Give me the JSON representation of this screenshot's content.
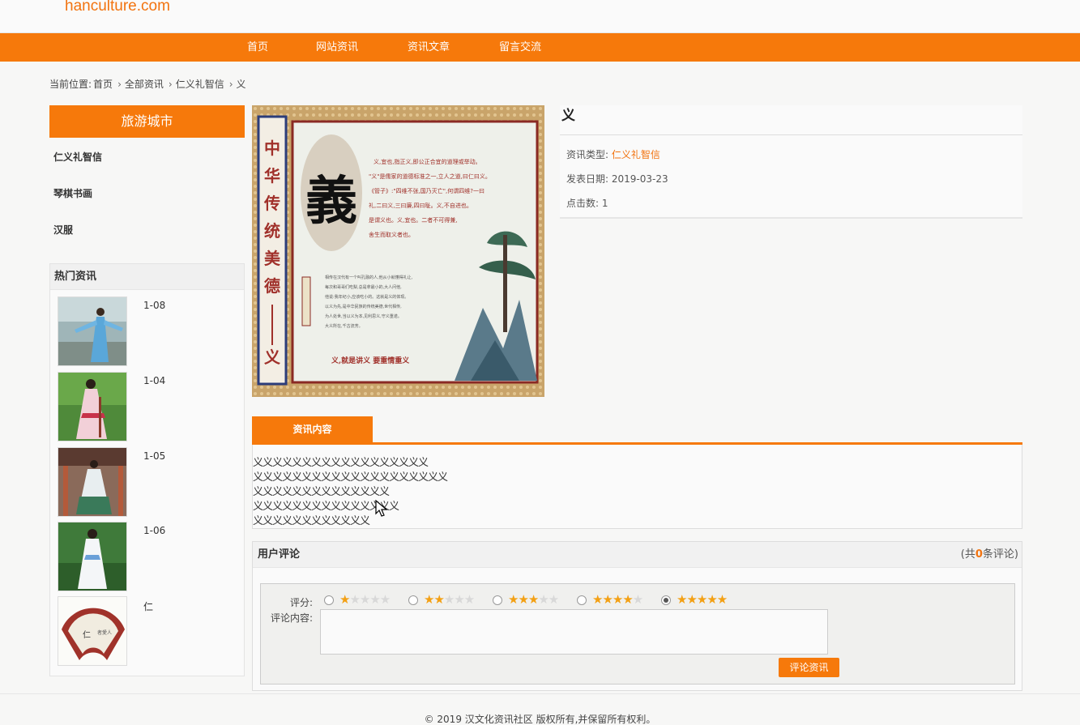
{
  "site": {
    "logo": "hanculture.com"
  },
  "nav": {
    "items": [
      {
        "label": "首页"
      },
      {
        "label": "网站资讯"
      },
      {
        "label": "资讯文章"
      },
      {
        "label": "留言交流"
      }
    ]
  },
  "breadcrumb": {
    "prefix": "当前位置:",
    "items": [
      "首页",
      "全部资讯",
      "仁义礼智信",
      "义"
    ]
  },
  "sidebar": {
    "category_header": "旅游城市",
    "categories": [
      "仁义礼智信",
      "琴棋书画",
      "汉服"
    ],
    "hot_title": "热门资讯",
    "hot_items": [
      {
        "date": "1-08",
        "thumb": "hanfu-blue-photo"
      },
      {
        "date": "1-04",
        "thumb": "hanfu-pink-photo"
      },
      {
        "date": "1-05",
        "thumb": "hanfu-green-photo"
      },
      {
        "date": "1-06",
        "thumb": "hanfu-white-photo"
      },
      {
        "date": "仁",
        "thumb": "fan-painting"
      }
    ]
  },
  "article": {
    "title": "义",
    "type_label": "资讯类型:",
    "type_value": "仁义礼智信",
    "date_label": "发表日期:",
    "date_value": "2019-03-23",
    "clicks_label": "点击数:",
    "clicks_value": "1",
    "image": {
      "vertical_title": "中华传统美德——义",
      "big_char": "義",
      "caption": "义,就是讲义  要重情重义",
      "seal": "传统美德"
    },
    "tab_label": "资讯内容",
    "content_lines": [
      "义义义义义义义义义义义义义义义义义义",
      "义义义义义义义义义义义义义义义义义义义义",
      "义义义义义义义义义义义义义义",
      "义义义义义义义义义义义义义义义",
      "义义义义义义义义义义义义"
    ]
  },
  "comments": {
    "title": "用户评论",
    "count_prefix": "(共",
    "count": "0",
    "count_suffix": "条评论)",
    "rating_label": "评分:",
    "ratings": [
      1,
      2,
      3,
      4,
      5
    ],
    "selected_rating": 5,
    "content_label": "评论内容:",
    "submit_label": "评论资讯"
  },
  "footer": {
    "text": "© 2019 汉文化资讯社区 版权所有,并保留所有权利。"
  },
  "colors": {
    "accent": "#f6790b",
    "star": "#f3a014"
  }
}
